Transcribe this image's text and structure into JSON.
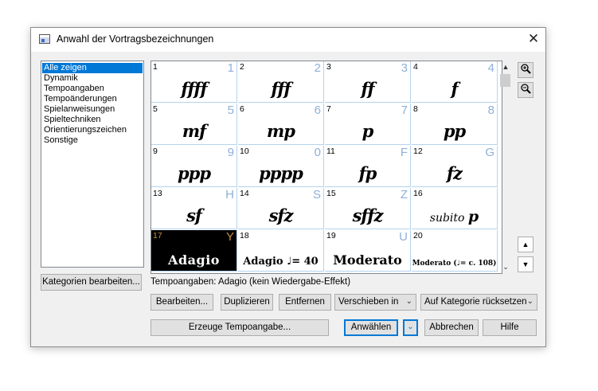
{
  "window": {
    "title": "Anwahl der Vortragsbezeichnungen",
    "close_glyph": "✕"
  },
  "categories": [
    {
      "label": "Alle zeigen",
      "selected": true
    },
    {
      "label": "Dynamik"
    },
    {
      "label": "Tempoangaben"
    },
    {
      "label": "Tempoänderungen"
    },
    {
      "label": "Spielanweisungen"
    },
    {
      "label": "Spieltechniken"
    },
    {
      "label": "Orientierungszeichen"
    },
    {
      "label": "Sonstige"
    }
  ],
  "buttons": {
    "edit_categories": "Kategorien bearbeiten...",
    "edit": "Bearbeiten...",
    "duplicate": "Duplizieren",
    "remove": "Entfernen",
    "create_tempo": "Erzeuge Tempoangabe...",
    "select": "Anwählen",
    "cancel": "Abbrechen",
    "help": "Hilfe"
  },
  "combos": {
    "move_into": "Verschieben in",
    "reset_category": "Auf Kategorie rücksetzen"
  },
  "status_text": "Tempoangaben: Adagio (kein Wiedergabe-Effekt)",
  "icons": {
    "zoom_in": "🔍+",
    "zoom_out": "🔍−",
    "scroll_up": "▲",
    "scroll_down": "▼",
    "page_up": "▲",
    "page_down": "▼",
    "dropdown": "⌄"
  },
  "cells": [
    {
      "num": "1",
      "key": "1",
      "sym": "ffff"
    },
    {
      "num": "2",
      "key": "2",
      "sym": "fff"
    },
    {
      "num": "3",
      "key": "3",
      "sym": "ff"
    },
    {
      "num": "4",
      "key": "4",
      "sym": "f"
    },
    {
      "num": "5",
      "key": "5",
      "sym": "mf"
    },
    {
      "num": "6",
      "key": "6",
      "sym": "mp"
    },
    {
      "num": "7",
      "key": "7",
      "sym": "p"
    },
    {
      "num": "8",
      "key": "8",
      "sym": "pp"
    },
    {
      "num": "9",
      "key": "9",
      "sym": "ppp"
    },
    {
      "num": "10",
      "key": "0",
      "sym": "pppp"
    },
    {
      "num": "11",
      "key": "F",
      "sym": "fp"
    },
    {
      "num": "12",
      "key": "G",
      "sym": "fz"
    },
    {
      "num": "13",
      "key": "H",
      "sym": "sf"
    },
    {
      "num": "14",
      "key": "S",
      "sym": "sfz"
    },
    {
      "num": "15",
      "key": "Z",
      "sym": "sffz"
    },
    {
      "num": "16",
      "key": "",
      "sym": "subito",
      "sym2": "p"
    },
    {
      "num": "17",
      "key": "Y",
      "sym": "Adagio",
      "selected": true
    },
    {
      "num": "18",
      "key": "",
      "sym": "Adagio ♩= 40"
    },
    {
      "num": "19",
      "key": "U",
      "sym": "Moderato"
    },
    {
      "num": "20",
      "key": "",
      "sym": "Moderato (♩= c. 108)"
    }
  ],
  "colors": {
    "accent": "#0078d7",
    "selected_cell": "#000000",
    "key_hint": "#8fb0d8"
  }
}
